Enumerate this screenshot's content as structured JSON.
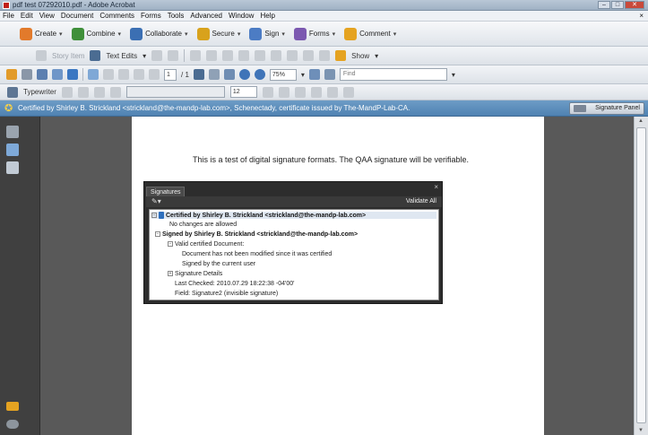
{
  "window": {
    "title": "pdf test 07292010.pdf - Adobe Acrobat",
    "controls": [
      "–",
      "□",
      "✕"
    ]
  },
  "menubar": {
    "items": [
      "File",
      "Edit",
      "View",
      "Document",
      "Comments",
      "Forms",
      "Tools",
      "Advanced",
      "Window",
      "Help"
    ],
    "close_glyph": "×"
  },
  "tasks": {
    "items": [
      {
        "label": "Create",
        "icon": "create-icon",
        "color": "#e27a2b"
      },
      {
        "label": "Combine",
        "icon": "combine-icon",
        "color": "#3f8f3a"
      },
      {
        "label": "Collaborate",
        "icon": "collaborate-icon",
        "color": "#3b6fb3"
      },
      {
        "label": "Secure",
        "icon": "lock-icon",
        "color": "#d8a21c"
      },
      {
        "label": "Sign",
        "icon": "pen-icon",
        "color": "#4c7cc4"
      },
      {
        "label": "Forms",
        "icon": "forms-icon",
        "color": "#7b58b0"
      },
      {
        "label": "Comment",
        "icon": "comment-icon",
        "color": "#e5a321"
      }
    ]
  },
  "toolbar1": {
    "story_label": "Story Item",
    "text_edits_label": "Text Edits",
    "show_label": "Show"
  },
  "toolbar2": {
    "page_current": "1",
    "page_total": "/ 1",
    "zoom": "75%",
    "find_placeholder": "Find"
  },
  "toolbar3": {
    "typewriter_label": "Typewriter",
    "font_size": "12"
  },
  "signature_bar": {
    "message": "Certified by Shirley B. Strickland <strickland@the-mandp-lab.com>, Schenectady, certificate issued by The-MandP-Lab-CA.",
    "panel_button": "Signature Panel"
  },
  "document": {
    "body_text": "This is a test of digital signature formats.  The QAA signature will be verifiable."
  },
  "signatures_panel": {
    "tab": "Signatures",
    "options_glyph": "✎▾",
    "validate_all": "Validate All",
    "close_glyph": "×",
    "rows": {
      "certified": "Certified by Shirley B. Strickland <strickland@the-mandp-lab.com>",
      "no_changes": "No changes are allowed",
      "signed": "Signed by Shirley B. Strickland <strickland@the-mandp-lab.com>",
      "valid_cert": "Valid certified Document:",
      "not_modified": "Document has not been modified since it was certified",
      "signed_by_user": "Signed by the current user",
      "sig_details": "Signature Details",
      "last_checked": "Last Checked: 2010.07.29 18:22:38 -04'00'",
      "field": "Field: Signature2 (invisible signature)"
    }
  }
}
